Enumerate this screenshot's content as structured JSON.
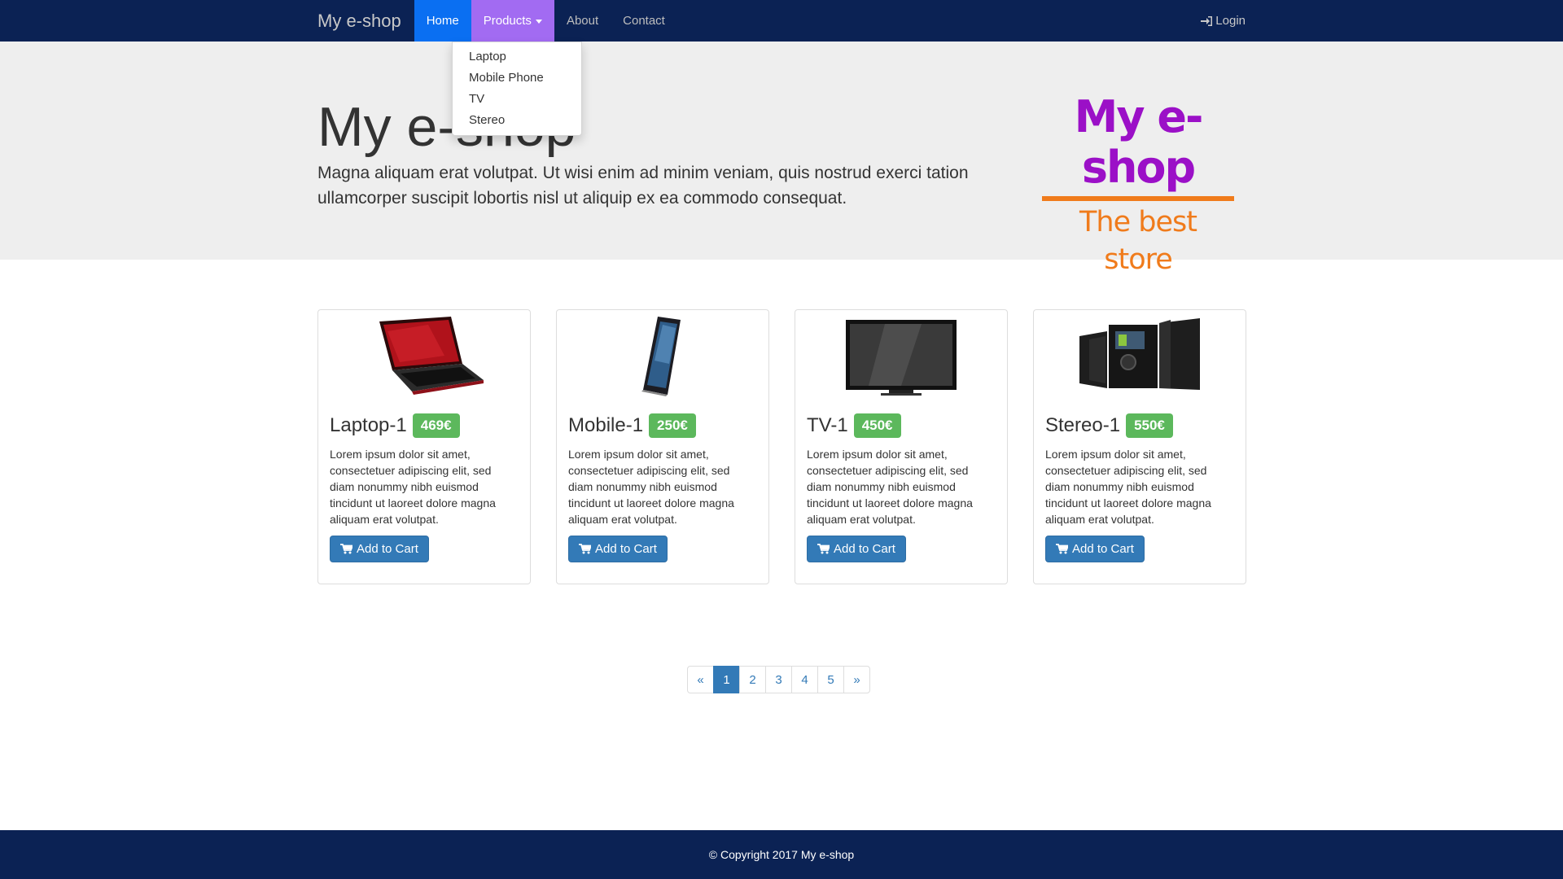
{
  "navbar": {
    "brand": "My e-shop",
    "links": [
      {
        "label": "Home"
      },
      {
        "label": "Products"
      },
      {
        "label": "About"
      },
      {
        "label": "Contact"
      }
    ],
    "login": "Login"
  },
  "dropdown": {
    "items": [
      "Laptop",
      "Mobile Phone",
      "TV",
      "Stereo"
    ]
  },
  "jumbotron": {
    "title": "My e-shop",
    "text": "Magna aliquam erat volutpat. Ut wisi enim ad minim veniam, quis nostrud exerci tation ullamcorper suscipit lobortis nisl ut aliquip ex ea commodo consequat."
  },
  "logo": {
    "top": "My e-shop",
    "bottom": "The best store"
  },
  "products": [
    {
      "name": "Laptop-1",
      "price": "469€",
      "desc": "Lorem ipsum dolor sit amet, consectetuer adipiscing elit, sed diam nonummy nibh euismod tincidunt ut laoreet dolore magna aliquam erat volutpat.",
      "button": "Add to Cart"
    },
    {
      "name": "Mobile-1",
      "price": "250€",
      "desc": "Lorem ipsum dolor sit amet, consectetuer adipiscing elit, sed diam nonummy nibh euismod tincidunt ut laoreet dolore magna aliquam erat volutpat.",
      "button": "Add to Cart"
    },
    {
      "name": "TV-1",
      "price": "450€",
      "desc": "Lorem ipsum dolor sit amet, consectetuer adipiscing elit, sed diam nonummy nibh euismod tincidunt ut laoreet dolore magna aliquam erat volutpat.",
      "button": "Add to Cart"
    },
    {
      "name": "Stereo-1",
      "price": "550€",
      "desc": "Lorem ipsum dolor sit amet, consectetuer adipiscing elit, sed diam nonummy nibh euismod tincidunt ut laoreet dolore magna aliquam erat volutpat.",
      "button": "Add to Cart"
    }
  ],
  "pagination": {
    "prev": "«",
    "pages": [
      "1",
      "2",
      "3",
      "4",
      "5"
    ],
    "next": "»",
    "active_page": "1"
  },
  "footer": {
    "copyright": "© Copyright 2017 My e-shop"
  },
  "colors": {
    "navbar_bg": "#0b2254",
    "home_active": "#0a6ff2",
    "products_active": "#a26bf2",
    "jumbotron_bg": "#eeeeee",
    "price_badge": "#5cb85c",
    "primary_button": "#337ab7",
    "logo_purple": "#9b10c7",
    "logo_orange": "#f07b1b"
  }
}
